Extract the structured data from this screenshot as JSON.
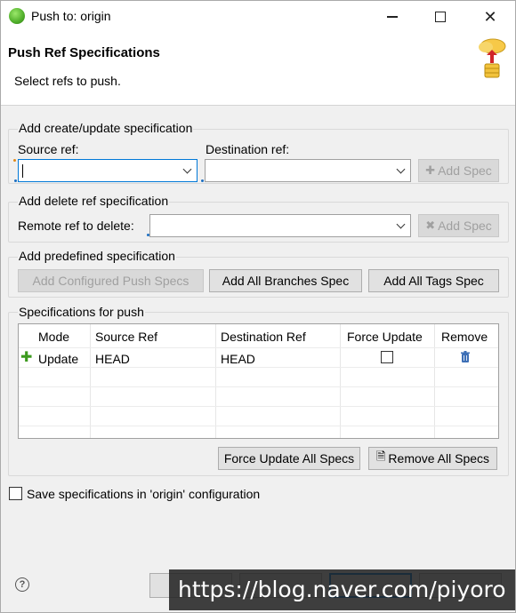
{
  "window": {
    "title": "Push to: origin"
  },
  "header": {
    "title": "Push Ref Specifications",
    "subtitle": "Select refs to push."
  },
  "create_group": {
    "label": "Add create/update specification",
    "source_label": "Source ref:",
    "source_value": "",
    "dest_label": "Destination ref:",
    "dest_value": "",
    "add_spec": "Add Spec"
  },
  "delete_group": {
    "label": "Add delete ref specification",
    "remote_label": "Remote ref to delete:",
    "remote_value": "",
    "add_spec": "Add Spec"
  },
  "predefined_group": {
    "label": "Add predefined specification",
    "configured": "Add Configured Push Specs",
    "all_branches": "Add All Branches Spec",
    "all_tags": "Add All Tags Spec"
  },
  "specs_group": {
    "label": "Specifications for push",
    "columns": [
      "Mode",
      "Source Ref",
      "Destination Ref",
      "Force Update",
      "Remove"
    ],
    "rows": [
      {
        "mode": "Update",
        "source": "HEAD",
        "dest": "HEAD",
        "force": false
      }
    ],
    "force_all": "Force Update All Specs",
    "remove_all": "Remove All Specs"
  },
  "save_config": {
    "label": "Save specifications in 'origin' configuration",
    "checked": false
  },
  "footer": {
    "back": "",
    "next": "",
    "finish": "",
    "cancel": ""
  },
  "watermark": "https://blog.naver.com/piyoro",
  "colors": {
    "focus_blue": "#0078d7",
    "required_blue": "#1c6fc2",
    "plus_green": "#3c9a1e"
  },
  "icons": [
    "app-icon",
    "minimize-icon",
    "maximize-icon",
    "close-icon",
    "push-cloud-icon",
    "add-spec-icon",
    "delete-spec-icon",
    "plus-icon",
    "trash-icon",
    "remove-all-icon",
    "help-icon"
  ]
}
